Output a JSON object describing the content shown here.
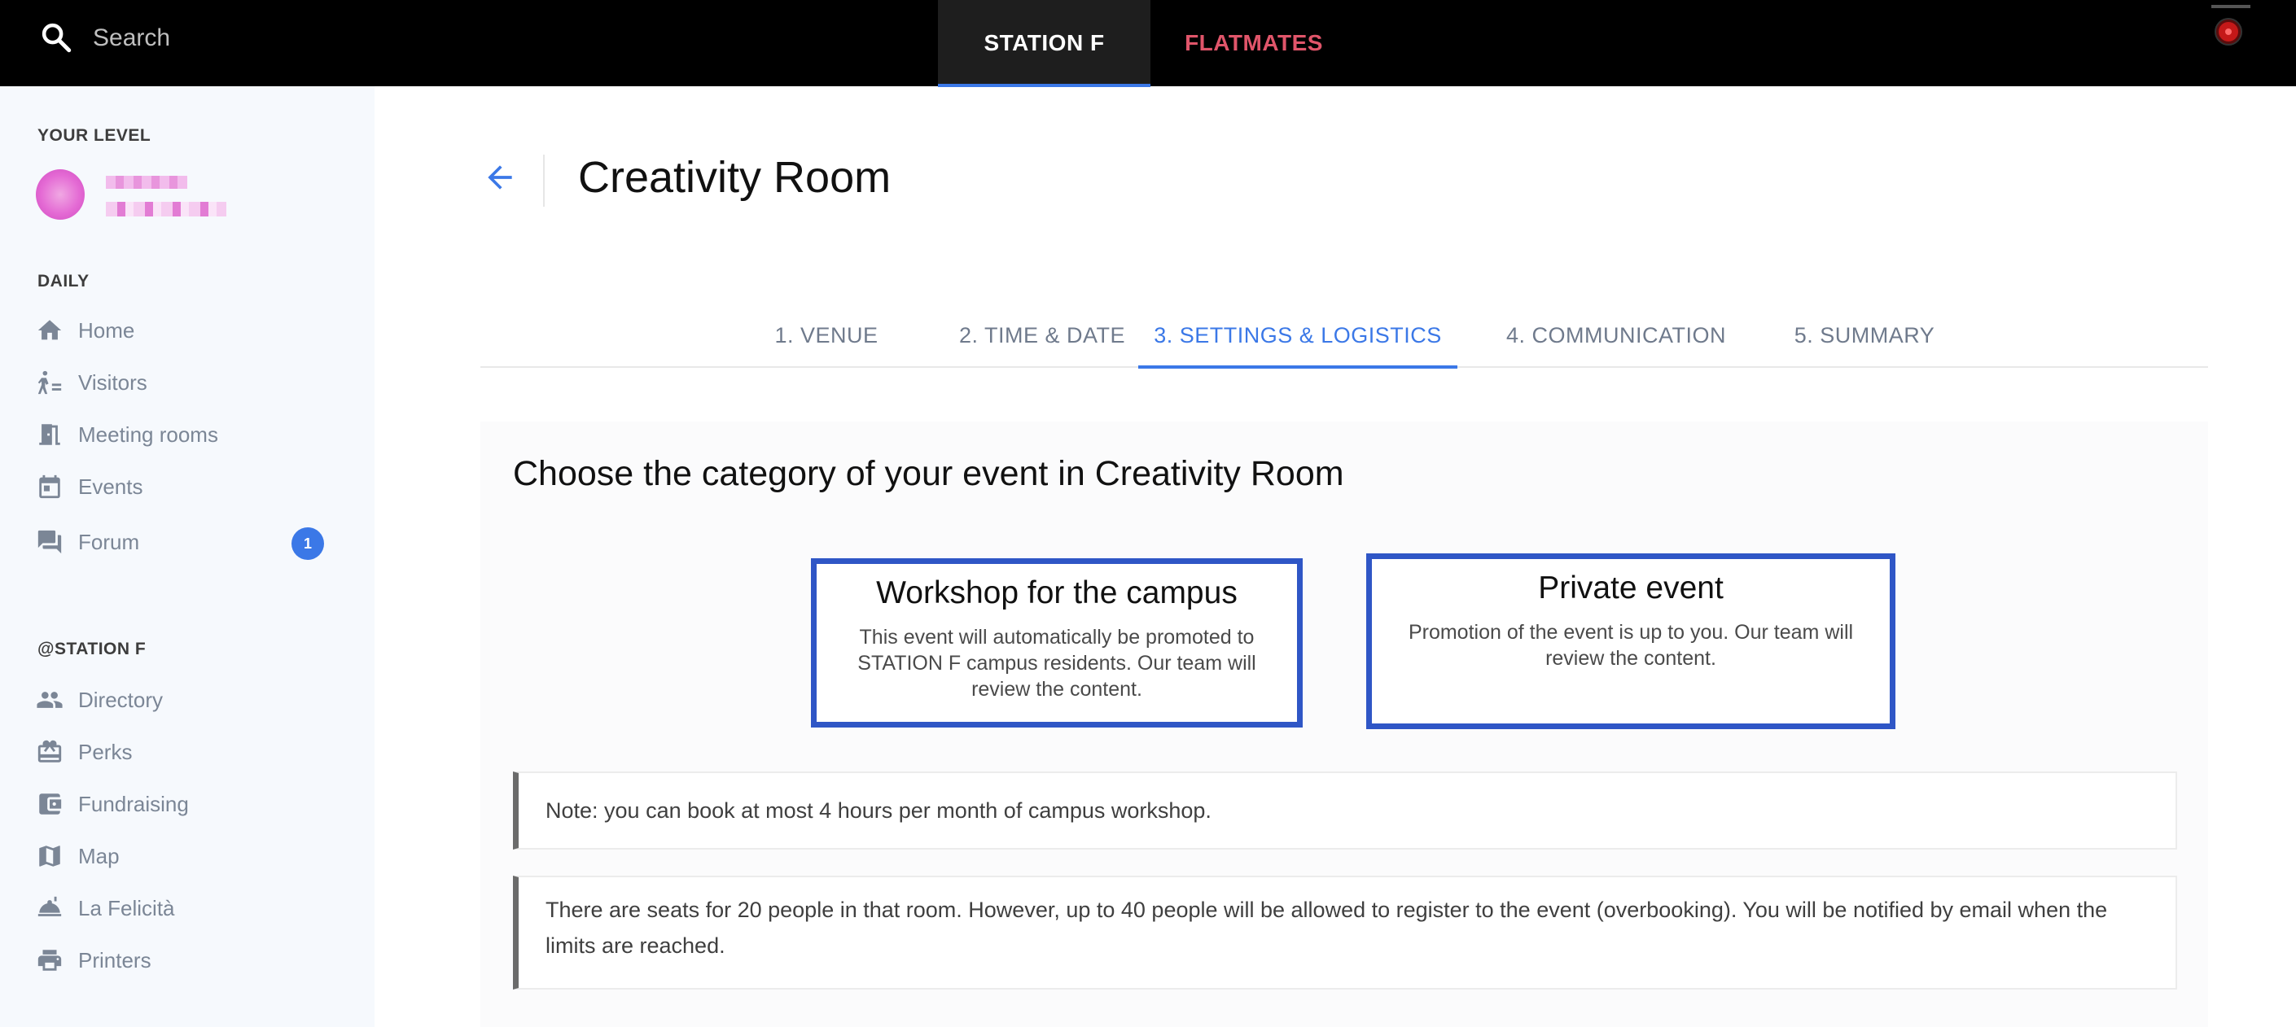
{
  "topbar": {
    "search_label": "Search",
    "tabs": [
      {
        "label": "STATION F",
        "active": true
      },
      {
        "label": "FLATMATES",
        "active": false,
        "color": "#e0556a"
      }
    ]
  },
  "sidebar": {
    "level_title": "YOUR LEVEL",
    "daily_title": "DAILY",
    "daily_items": [
      {
        "label": "Home",
        "icon": "home-icon"
      },
      {
        "label": "Visitors",
        "icon": "visitor-icon"
      },
      {
        "label": "Meeting rooms",
        "icon": "door-icon"
      },
      {
        "label": "Events",
        "icon": "calendar-icon"
      },
      {
        "label": "Forum",
        "icon": "forum-icon",
        "badge": "1"
      }
    ],
    "station_title": "@STATION F",
    "station_items": [
      {
        "label": "Directory",
        "icon": "people-icon"
      },
      {
        "label": "Perks",
        "icon": "gift-icon"
      },
      {
        "label": "Fundraising",
        "icon": "wallet-icon"
      },
      {
        "label": "Map",
        "icon": "map-icon"
      },
      {
        "label": "La Felicità",
        "icon": "food-icon"
      },
      {
        "label": "Printers",
        "icon": "printer-icon"
      }
    ]
  },
  "main": {
    "title": "Creativity Room",
    "steps": [
      {
        "label": "1. VENUE",
        "active": false
      },
      {
        "label": "2. TIME & DATE",
        "active": false
      },
      {
        "label": "3. SETTINGS & LOGISTICS",
        "active": true
      },
      {
        "label": "4. COMMUNICATION",
        "active": false
      },
      {
        "label": "5. SUMMARY",
        "active": false
      }
    ],
    "heading": "Choose the category of your event in Creativity Room",
    "cards": [
      {
        "title": "Workshop for the campus",
        "desc": "This event will automatically be promoted to STATION F campus residents. Our team will review the content."
      },
      {
        "title": "Private event",
        "desc": "Promotion of the event is up to you. Our team will review the content."
      }
    ],
    "notes": [
      "Note: you can book at most 4 hours per month of campus workshop.",
      "There are seats for 20 people in that room. However, up to 40 people will be allowed to register to the event (overbooking). You will be notified by email when the limits are reached."
    ]
  },
  "colors": {
    "accent": "#3b78e7",
    "card_border": "#2f56c6",
    "flatmates": "#e0556a"
  }
}
